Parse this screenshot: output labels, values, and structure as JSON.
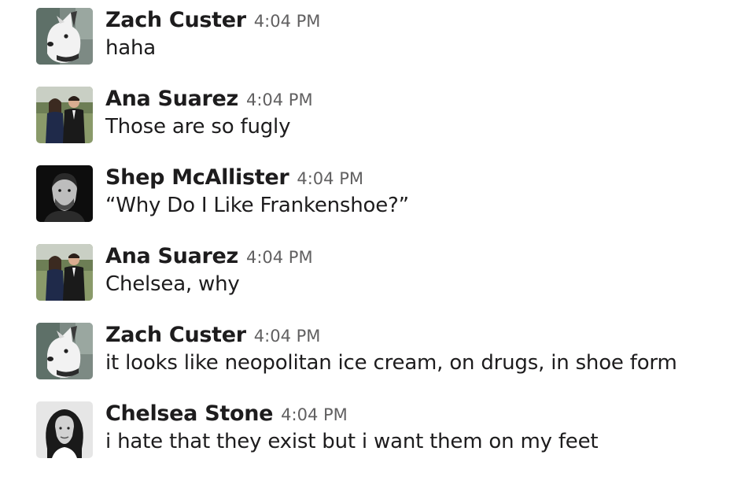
{
  "messages": [
    {
      "sender": "Zach Custer",
      "time": "4:04 PM",
      "text": "haha",
      "avatar": "dog-avatar"
    },
    {
      "sender": "Ana Suarez",
      "time": "4:04 PM",
      "text": "Those are so fugly",
      "avatar": "couple-avatar"
    },
    {
      "sender": "Shep McAllister",
      "time": "4:04 PM",
      "text": "“Why Do I Like Frankenshoe?”",
      "avatar": "man-bw-avatar"
    },
    {
      "sender": "Ana Suarez",
      "time": "4:04 PM",
      "text": "Chelsea, why",
      "avatar": "couple-avatar"
    },
    {
      "sender": "Zach Custer",
      "time": "4:04 PM",
      "text": "it looks like neopolitan ice cream, on drugs, in shoe form",
      "avatar": "dog-avatar"
    },
    {
      "sender": "Chelsea Stone",
      "time": "4:04 PM",
      "text": "i hate that they exist but i want them on my feet",
      "avatar": "woman-bw-avatar"
    }
  ],
  "colors": {
    "sender": "#1d1c1d",
    "timestamp": "#616061",
    "text": "#1d1c1d",
    "background": "#ffffff"
  }
}
